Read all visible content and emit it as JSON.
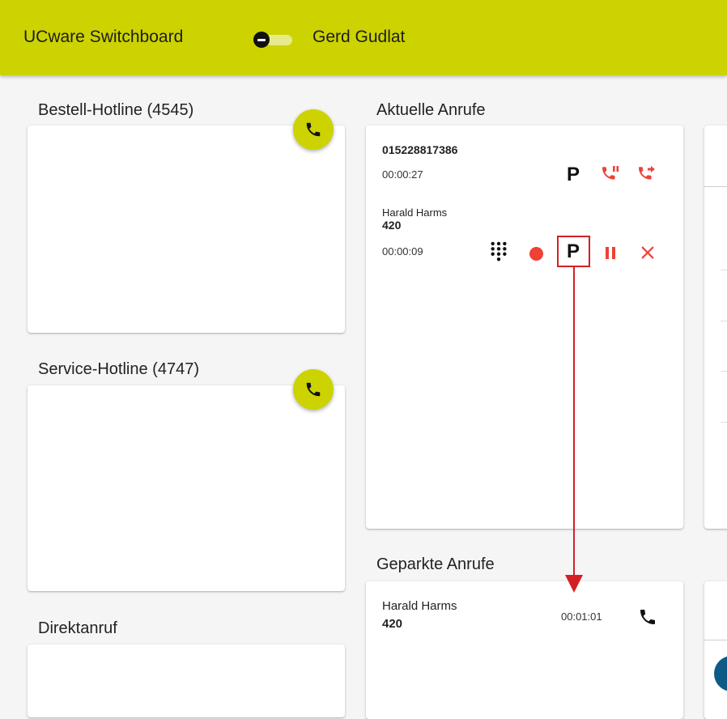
{
  "header": {
    "app_title": "UCware Switchboard",
    "user_name": "Gerd Gudlat",
    "bg_color": "#ccd300"
  },
  "queues": [
    {
      "title": "Bestell-Hotline (4545)",
      "action_icon": "phone-icon"
    },
    {
      "title": "Service-Hotline (4747)",
      "action_icon": "phone-icon"
    },
    {
      "title": "Direktanruf"
    }
  ],
  "current_calls": {
    "title": "Aktuelle Anrufe",
    "calls": [
      {
        "number": "015228817386",
        "duration": "00:00:27",
        "actions": [
          "park-icon",
          "hold-call-icon",
          "transfer-call-icon"
        ]
      },
      {
        "name": "Harald Harms",
        "extension": "420",
        "duration": "00:00:09",
        "actions": [
          "dialpad-icon",
          "record-icon",
          "park-icon",
          "pause-icon",
          "hangup-icon"
        ]
      }
    ]
  },
  "parked_calls": {
    "title": "Geparkte Anrufe",
    "calls": [
      {
        "name": "Harald Harms",
        "extension": "420",
        "duration": "00:01:01",
        "action_icon": "phone-icon"
      }
    ]
  },
  "colors": {
    "accent": "#ccd300",
    "action_red": "#ef4136",
    "annotation_red": "#d32027"
  }
}
